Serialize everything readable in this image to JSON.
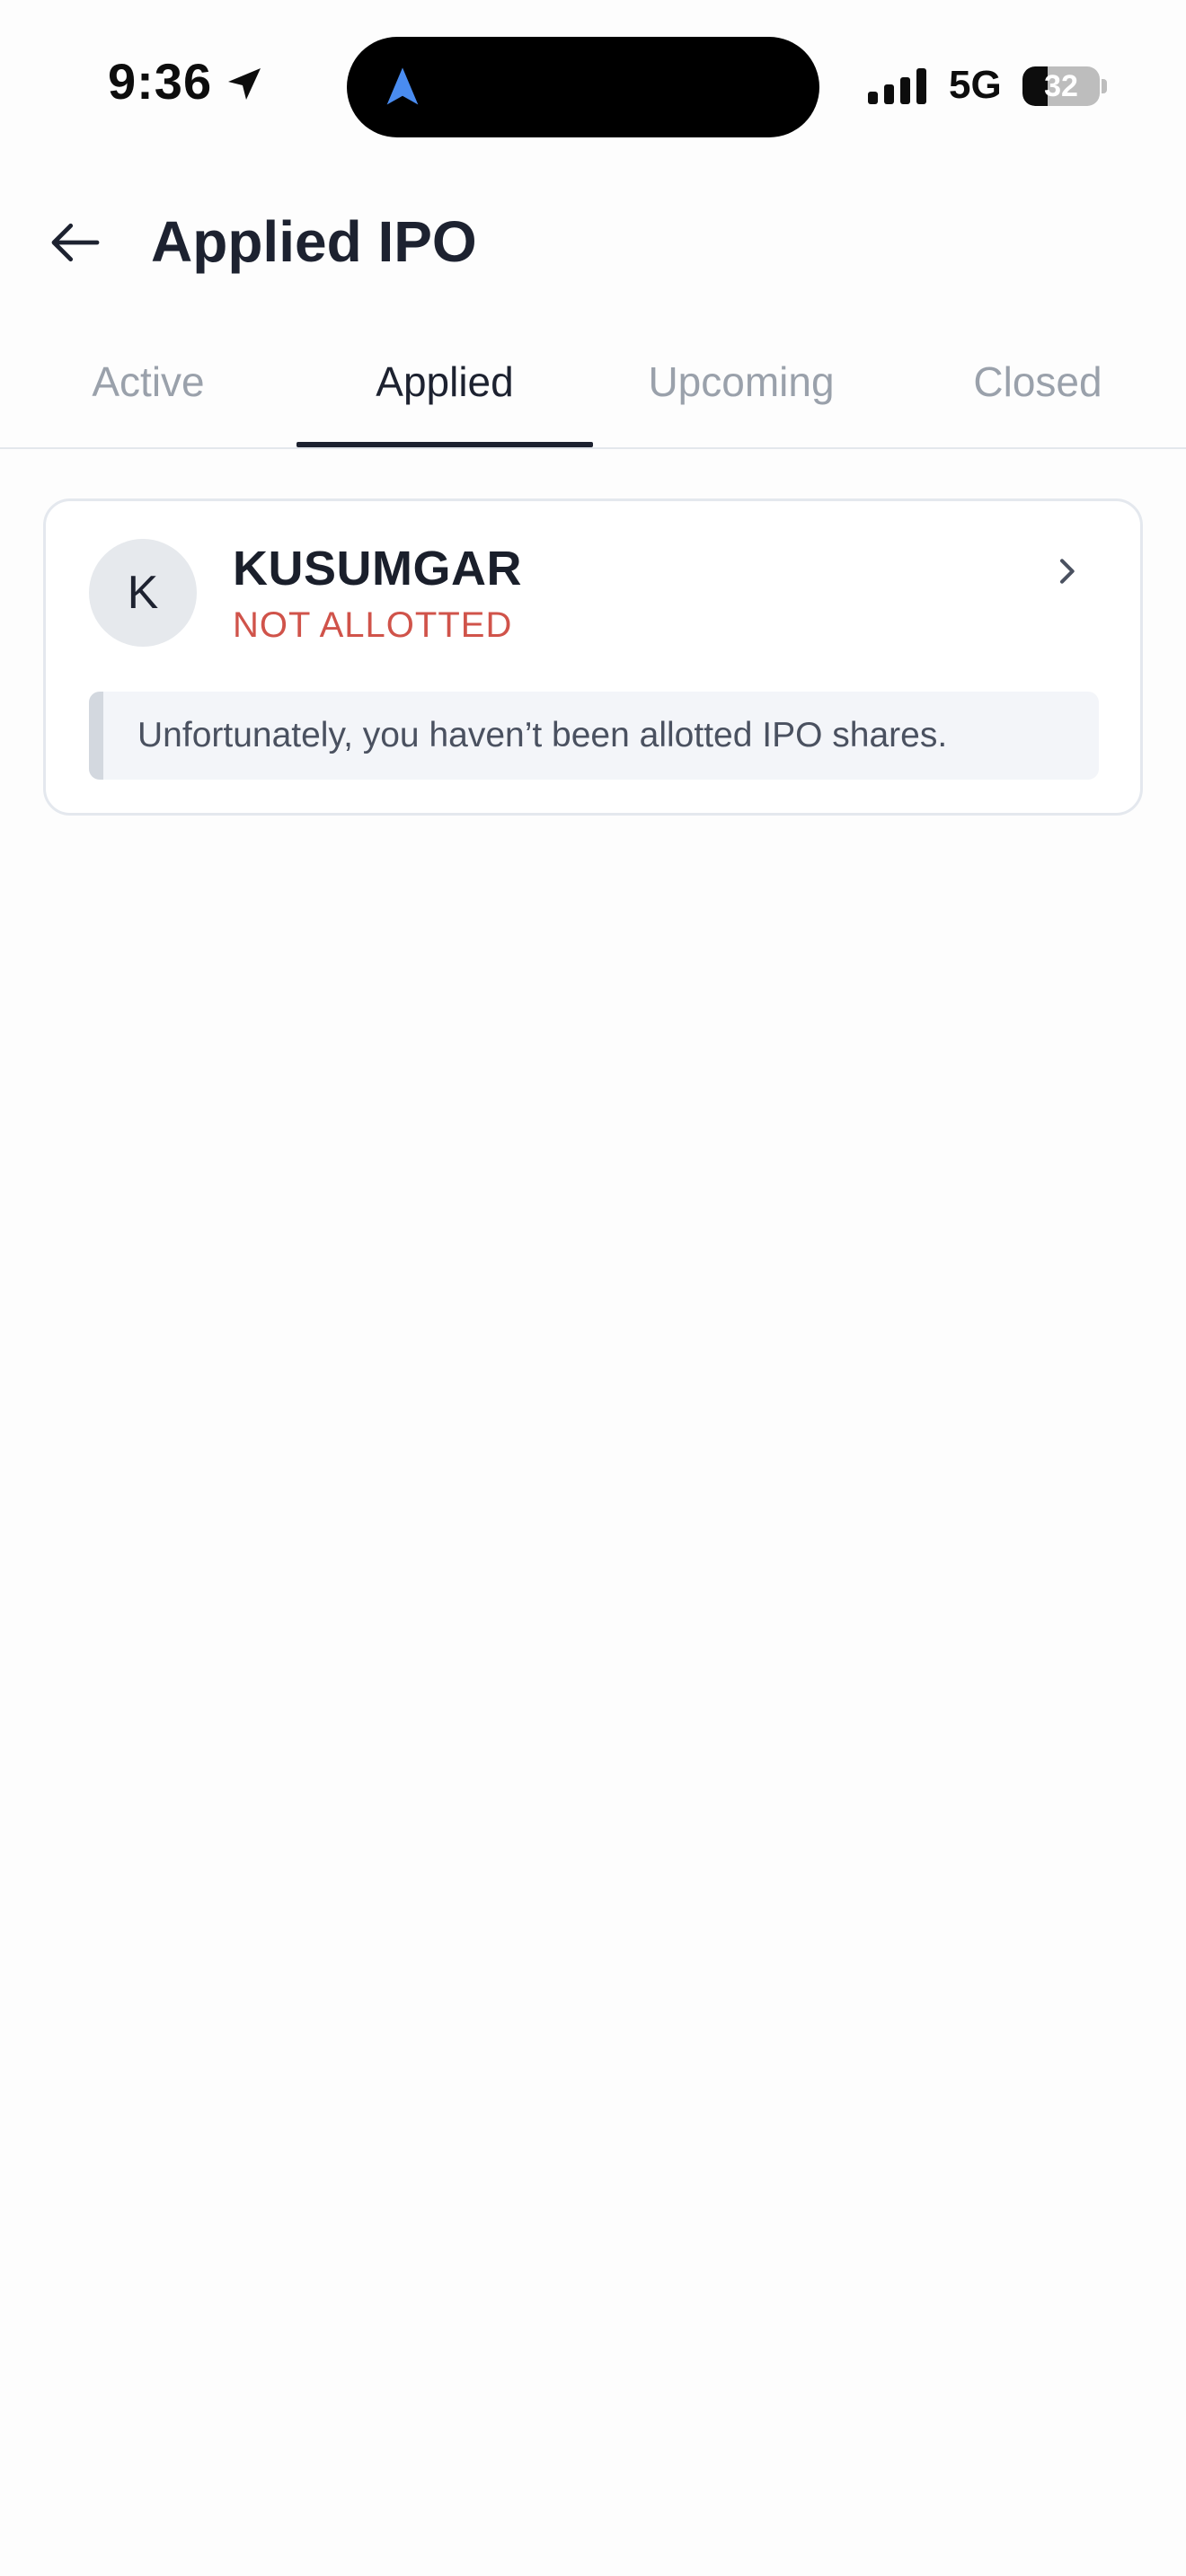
{
  "status_bar": {
    "time": "9:36",
    "network": "5G",
    "battery": "32",
    "battery_level_percent": 32
  },
  "header": {
    "title": "Applied IPO",
    "back_icon": "arrow-left-icon"
  },
  "tabs": [
    {
      "label": "Active",
      "active": false
    },
    {
      "label": "Applied",
      "active": true
    },
    {
      "label": "Upcoming",
      "active": false
    },
    {
      "label": "Closed",
      "active": false
    }
  ],
  "ipo_card": {
    "avatar_letter": "K",
    "company": "KUSUMGAR",
    "status": "NOT ALLOTTED",
    "message": "Unfortunately, you haven’t been allotted IPO shares.",
    "chevron_icon": "chevron-right-icon"
  },
  "colors": {
    "status_red": "#d0534a",
    "text_dark": "#1d2230",
    "tab_inactive": "#9aa1ab",
    "island_nav": "#4a8cf0"
  }
}
